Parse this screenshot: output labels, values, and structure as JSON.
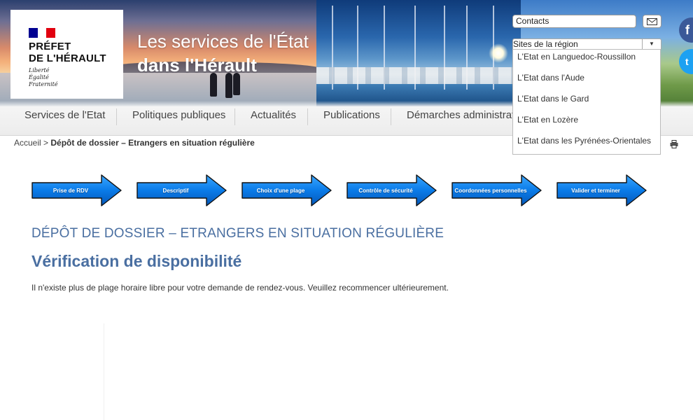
{
  "header": {
    "logo": {
      "line1": "PRÉFET",
      "line2": "DE L'HÉRAULT",
      "motto": [
        "Liberté",
        "Égalité",
        "Fraternité"
      ]
    },
    "title_line1": "Les services de l'État",
    "title_line2": "dans l'Hérault",
    "contacts_label": "Contacts",
    "region_select": {
      "selected": "Sites de la région",
      "options": [
        "L'Etat en Languedoc-Roussillon",
        "L'Etat dans l'Aude",
        "L'Etat dans le Gard",
        "L'Etat en Lozère",
        "L'Etat dans les Pyrénées-Orientales"
      ]
    },
    "social": {
      "facebook_glyph": "f",
      "twitter_glyph": "t"
    }
  },
  "nav": {
    "items": [
      "Services de l'Etat",
      "Politiques publiques",
      "Actualités",
      "Publications",
      "Démarches administrat"
    ]
  },
  "breadcrumb": {
    "home": "Accueil",
    "separator": ">",
    "current": "Dépôt de dossier – Etrangers en situation régulière"
  },
  "steps": [
    "Prise de RDV",
    "Descriptif",
    "Choix d'une plage",
    "Contrôle de sécurité",
    "Coordonnées personnelles",
    "Valider et terminer"
  ],
  "content": {
    "page_heading": "DÉPÔT DE DOSSIER – ETRANGERS EN SITUATION RÉGULIÈRE",
    "sub_heading": "Vérification de disponibilité",
    "message": "Il n'existe plus de plage horaire libre pour votre demande de rendez-vous. Veuillez recommencer ultérieurement."
  },
  "colors": {
    "heading_blue": "#4a6fa1",
    "flag_blue": "#000091",
    "flag_red": "#e1000f",
    "step_blue": "#0a7be8"
  },
  "icons": [
    "mail-icon",
    "print-icon",
    "facebook-icon",
    "twitter-icon",
    "dropdown-arrow-icon",
    "step-arrow-icon"
  ]
}
